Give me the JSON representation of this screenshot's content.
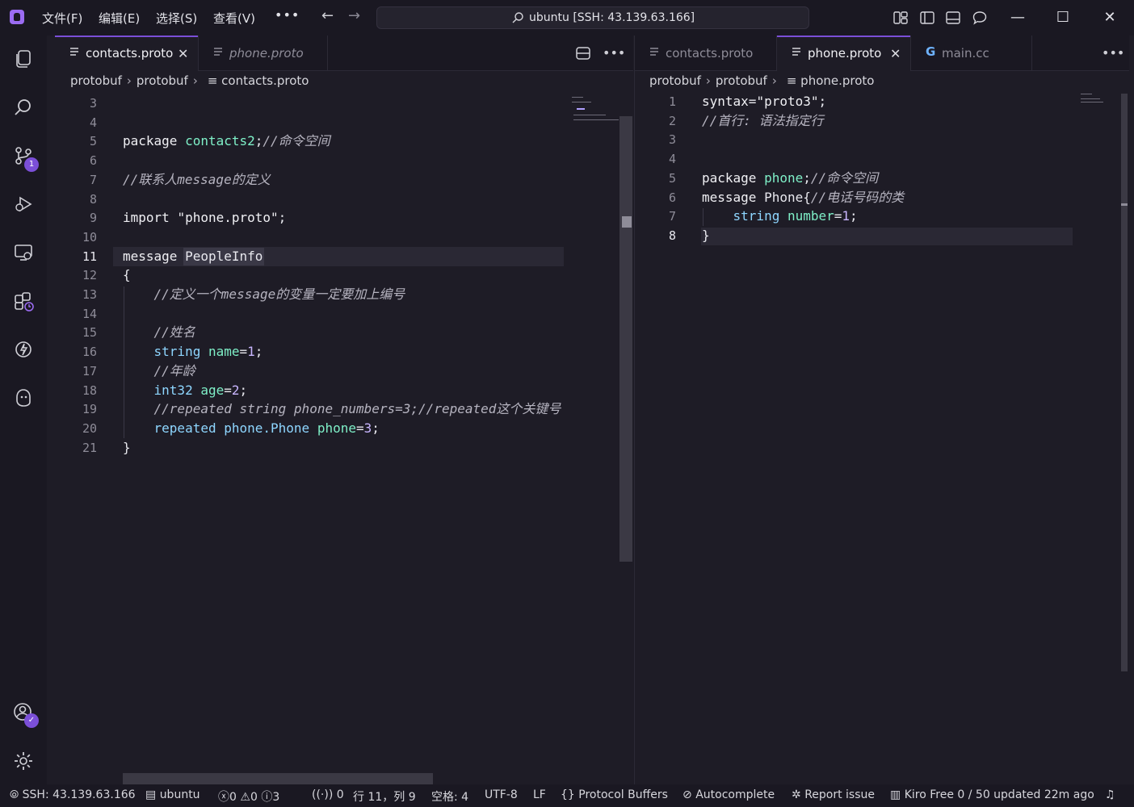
{
  "menu": [
    "文件(F)",
    "编辑(E)",
    "选择(S)",
    "查看(V)"
  ],
  "search": {
    "text": "ubuntu [SSH: 43.139.63.166]"
  },
  "colors": {
    "accent": "#7b4fd8",
    "background": "#1e1c26",
    "chrome": "#1a1822"
  },
  "activity": {
    "source_control_badge": "1"
  },
  "left_group": {
    "tabs": [
      {
        "label": "contacts.proto",
        "active": true
      },
      {
        "label": "phone.proto",
        "active": false,
        "italic": true
      }
    ],
    "breadcrumb": [
      "protobuf",
      "protobuf",
      "contacts.proto"
    ],
    "current_line": 11,
    "lines": [
      {
        "n": "3",
        "code": []
      },
      {
        "n": "4",
        "code": []
      },
      {
        "n": "5",
        "code": [
          [
            "kw",
            "package "
          ],
          [
            "id",
            "contacts2"
          ],
          [
            "pl",
            ";"
          ],
          [
            "cm",
            "//命令空间"
          ]
        ]
      },
      {
        "n": "6",
        "code": []
      },
      {
        "n": "7",
        "code": [
          [
            "cm",
            "//联系人message的定义"
          ]
        ]
      },
      {
        "n": "8",
        "code": []
      },
      {
        "n": "9",
        "code": [
          [
            "kw",
            "import "
          ],
          [
            "str",
            "\"phone.proto\""
          ],
          [
            "pl",
            ";"
          ]
        ]
      },
      {
        "n": "10",
        "code": []
      },
      {
        "n": "11",
        "code": [
          [
            "kw",
            "message "
          ],
          [
            "pl",
            "PeopleInfo"
          ]
        ]
      },
      {
        "n": "12",
        "code": [
          [
            "pl",
            "{"
          ]
        ]
      },
      {
        "n": "13",
        "code": [
          [
            "pl",
            "    "
          ],
          [
            "cm",
            "//定义一个message的变量一定要加上编号"
          ]
        ]
      },
      {
        "n": "14",
        "code": []
      },
      {
        "n": "15",
        "code": [
          [
            "pl",
            "    "
          ],
          [
            "cm",
            "//姓名"
          ]
        ]
      },
      {
        "n": "16",
        "code": [
          [
            "pl",
            "    "
          ],
          [
            "ty",
            "string "
          ],
          [
            "id",
            "name"
          ],
          [
            "pl",
            "="
          ],
          [
            "num",
            "1"
          ],
          [
            "pl",
            ";"
          ]
        ]
      },
      {
        "n": "17",
        "code": [
          [
            "pl",
            "    "
          ],
          [
            "cm",
            "//年龄"
          ]
        ]
      },
      {
        "n": "18",
        "code": [
          [
            "pl",
            "    "
          ],
          [
            "ty",
            "int32 "
          ],
          [
            "id",
            "age"
          ],
          [
            "pl",
            "="
          ],
          [
            "num",
            "2"
          ],
          [
            "pl",
            ";"
          ]
        ]
      },
      {
        "n": "19",
        "code": [
          [
            "pl",
            "    "
          ],
          [
            "cm",
            "//repeated string phone_numbers=3;//repeated这个关键号"
          ]
        ]
      },
      {
        "n": "20",
        "code": [
          [
            "pl",
            "    "
          ],
          [
            "ty",
            "repeated phone.Phone "
          ],
          [
            "id",
            "phone"
          ],
          [
            "pl",
            "="
          ],
          [
            "num",
            "3"
          ],
          [
            "pl",
            ";"
          ]
        ]
      },
      {
        "n": "21",
        "code": [
          [
            "pl",
            "}"
          ]
        ]
      }
    ]
  },
  "right_group": {
    "tabs": [
      {
        "label": "contacts.proto",
        "active": false
      },
      {
        "label": "phone.proto",
        "active": true
      },
      {
        "label": "main.cc",
        "active": false
      }
    ],
    "breadcrumb": [
      "protobuf",
      "protobuf",
      "phone.proto"
    ],
    "current_line": 8,
    "lines": [
      {
        "n": "1",
        "code": [
          [
            "kw",
            "syntax"
          ],
          [
            "pl",
            "="
          ],
          [
            "str",
            "\"proto3\""
          ],
          [
            "pl",
            ";"
          ]
        ]
      },
      {
        "n": "2",
        "code": [
          [
            "cm",
            "//首行: 语法指定行"
          ]
        ]
      },
      {
        "n": "3",
        "code": []
      },
      {
        "n": "4",
        "code": []
      },
      {
        "n": "5",
        "code": [
          [
            "kw",
            "package "
          ],
          [
            "id",
            "phone"
          ],
          [
            "pl",
            ";"
          ],
          [
            "cm",
            "//命令空间"
          ]
        ]
      },
      {
        "n": "6",
        "code": [
          [
            "kw",
            "message "
          ],
          [
            "pl",
            "Phone{"
          ],
          [
            "cm",
            "//电话号码的类"
          ]
        ]
      },
      {
        "n": "7",
        "code": [
          [
            "pl",
            "    "
          ],
          [
            "ty",
            "string "
          ],
          [
            "id",
            "number"
          ],
          [
            "pl",
            "="
          ],
          [
            "num",
            "1"
          ],
          [
            "pl",
            ";"
          ]
        ]
      },
      {
        "n": "8",
        "code": [
          [
            "pl",
            "}"
          ]
        ]
      }
    ]
  },
  "status": {
    "remote": "SSH: 43.139.63.166",
    "host": "ubuntu",
    "errors": "0",
    "warnings": "0",
    "infos": "3",
    "ports": "0",
    "position": "行 11，列 9",
    "spaces": "空格: 4",
    "encoding": "UTF-8",
    "eol": "LF",
    "language": "Protocol Buffers",
    "autocomplete": "Autocomplete",
    "report": "Report issue",
    "kiro": "Kiro Free 0 / 50 updated 22m ago"
  }
}
